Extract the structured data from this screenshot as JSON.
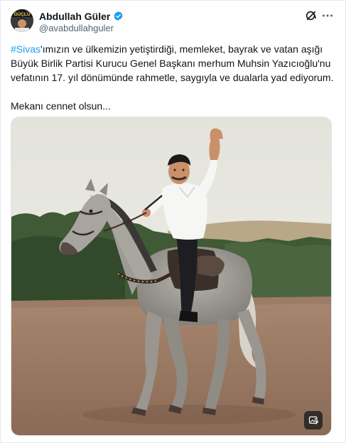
{
  "author": {
    "display_name": "Abdullah Güler",
    "handle": "@avabdullahguler",
    "avatar_text": "GÜÇLÜ",
    "verified": true
  },
  "post": {
    "hashtag": "#Sivas",
    "text_line1_rest": "'ımızın ve ülkemizin yetiştirdiği, memleket, bayrak ve vatan aşığı",
    "text_line2": "Büyük Birlik Partisi Kurucu Genel Başkanı merhum Muhsin Yazıcıoğlu'nu",
    "text_line3": "vefatının 17. yıl dönümünde rahmetle, saygıyla ve dualarla yad ediyorum.",
    "text_line4": "Mekanı cennet olsun..."
  },
  "icons": {
    "grok": "grok-icon",
    "more": "more-icon",
    "verified": "verified-badge-icon",
    "media_edit": "image-edit-icon"
  },
  "colors": {
    "accent": "#1d9bf0",
    "text": "#0f1419",
    "muted": "#536471"
  }
}
